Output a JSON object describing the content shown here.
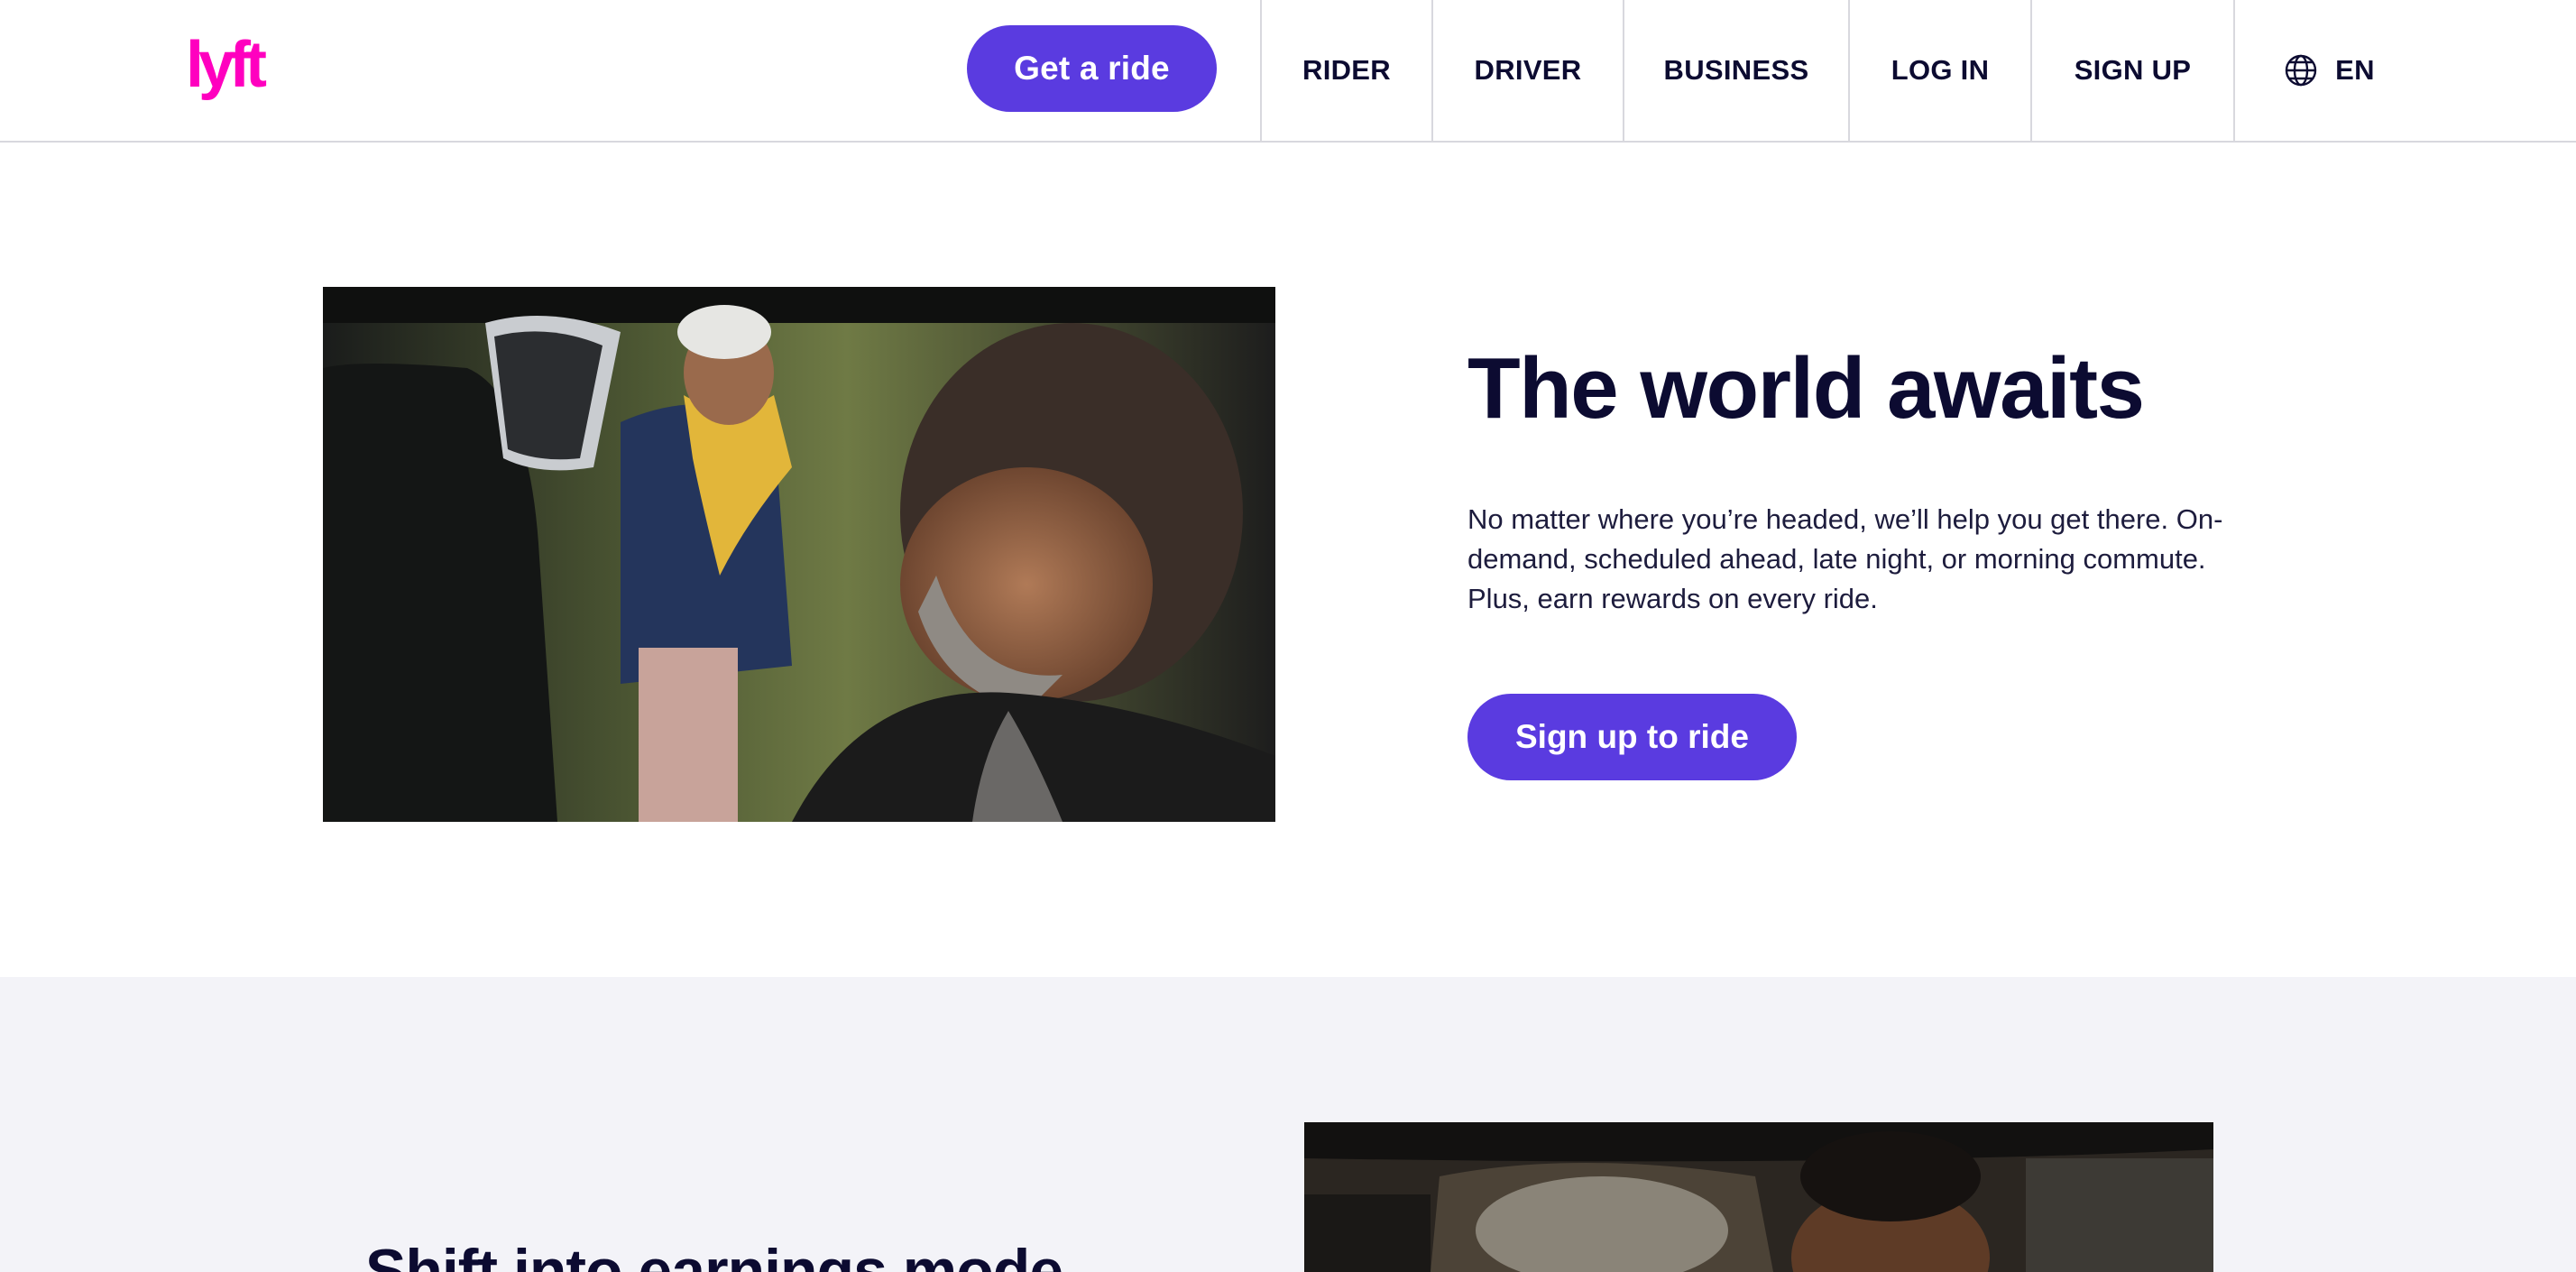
{
  "brand": {
    "logo_text": "lyft",
    "color": "#ff00bf"
  },
  "header": {
    "cta_label": "Get a ride",
    "nav": [
      {
        "label": "RIDER"
      },
      {
        "label": "DRIVER"
      },
      {
        "label": "BUSINESS"
      },
      {
        "label": "LOG IN"
      },
      {
        "label": "SIGN UP"
      }
    ],
    "language": {
      "icon": "globe-icon",
      "label": "EN"
    }
  },
  "hero": {
    "title": "The world awaits",
    "body": "No matter where you’re headed, we’ll help you get there. On-demand, scheduled ahead, late night, or morning commute. Plus, earn rewards on every ride.",
    "cta_label": "Sign up to ride"
  },
  "section_two": {
    "title": "Shift into earnings mode"
  },
  "colors": {
    "accent": "#5a3be0",
    "brand_pink": "#ff00bf",
    "text": "#0c0b31",
    "section_bg": "#f3f3f8",
    "divider": "#d8d8de"
  }
}
